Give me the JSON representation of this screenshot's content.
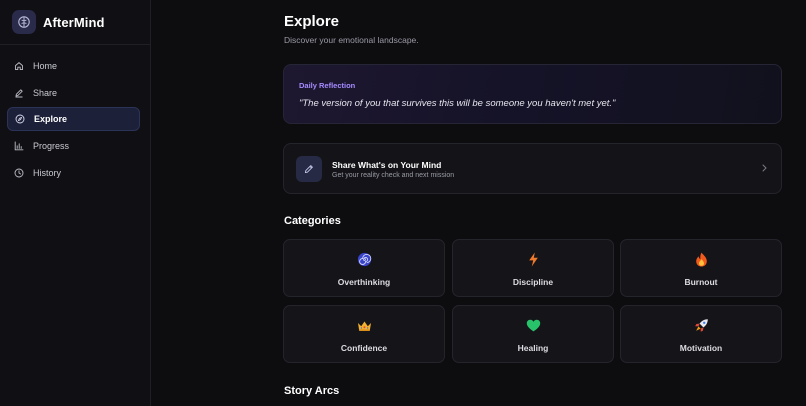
{
  "brand": {
    "name": "AfterMind"
  },
  "sidebar": {
    "items": [
      {
        "label": "Home",
        "icon": "home-icon"
      },
      {
        "label": "Share",
        "icon": "pencil-icon"
      },
      {
        "label": "Explore",
        "icon": "compass-icon",
        "active": true
      },
      {
        "label": "Progress",
        "icon": "bar-chart-icon"
      },
      {
        "label": "History",
        "icon": "clock-icon"
      }
    ]
  },
  "header": {
    "title": "Explore",
    "subtitle": "Discover your emotional landscape."
  },
  "reflection": {
    "tag": "Daily Reflection",
    "quote": "\"The version of you that survives this will be someone you haven't met yet.\""
  },
  "share": {
    "title": "Share What's on Your Mind",
    "subtitle": "Get your reality check and next mission"
  },
  "categories": {
    "title": "Categories",
    "items": [
      {
        "label": "Overthinking",
        "icon": "spiral-icon"
      },
      {
        "label": "Discipline",
        "icon": "lightning-icon"
      },
      {
        "label": "Burnout",
        "icon": "fire-icon"
      },
      {
        "label": "Confidence",
        "icon": "crown-icon"
      },
      {
        "label": "Healing",
        "icon": "green-heart-icon"
      },
      {
        "label": "Motivation",
        "icon": "rocket-icon"
      }
    ]
  },
  "story_arcs": {
    "title": "Story Arcs"
  },
  "colors": {
    "background": "#0d0d10",
    "sidebar": "#101014",
    "accent": "#a58bff",
    "active_nav": "#1c2038"
  }
}
